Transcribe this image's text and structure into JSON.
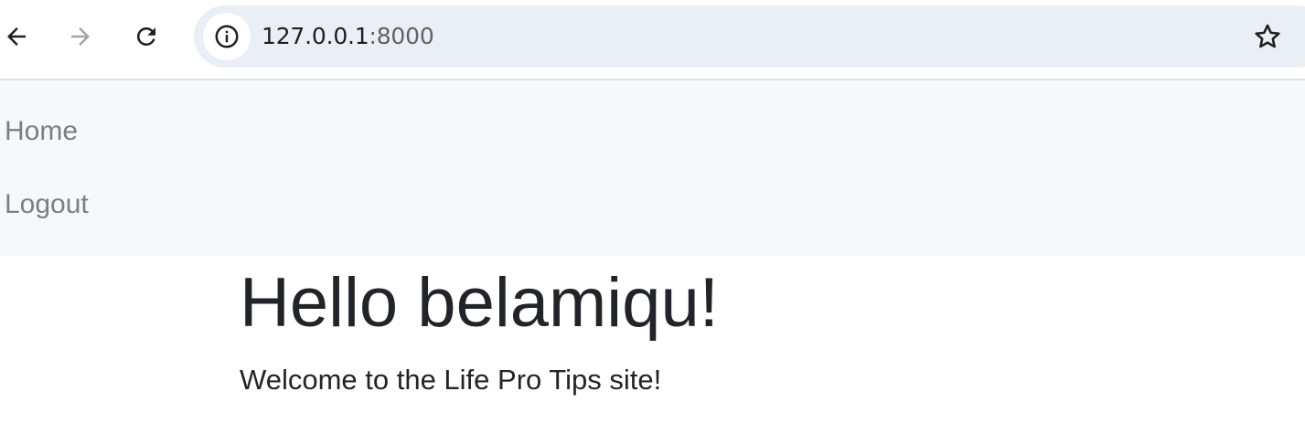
{
  "browser": {
    "url_host": "127.0.0.1",
    "url_port": ":8000",
    "icons": {
      "back": "arrow-left-icon",
      "forward": "arrow-right-icon",
      "reload": "reload-icon",
      "site_info": "info-icon",
      "bookmark": "star-icon"
    }
  },
  "navbar": {
    "items": [
      {
        "label": "Home"
      },
      {
        "label": "Logout"
      }
    ]
  },
  "main": {
    "greeting": "Hello belamiqu!",
    "welcome": "Welcome to the Life Pro Tips site!"
  },
  "colors": {
    "omnibox_bg": "#eaeef5",
    "navbar_bg": "#f7f8fa",
    "nav_link": "#7b7f83",
    "body_text": "#212529"
  }
}
